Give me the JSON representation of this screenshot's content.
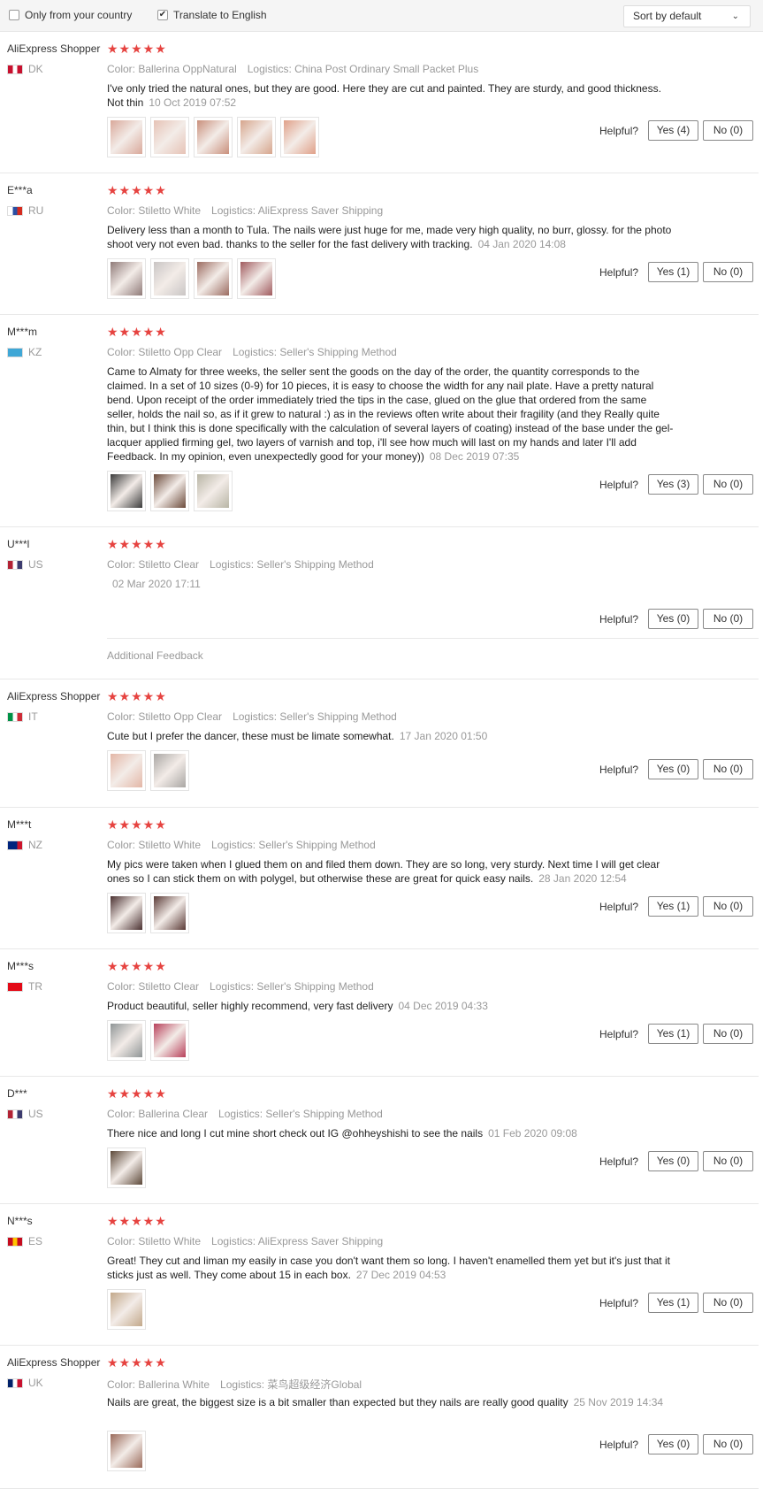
{
  "filters": {
    "only_country_label": "Only from your country",
    "translate_label": "Translate to English",
    "translate_checked_mark": "✔",
    "sort_label": "Sort by default",
    "sort_chevron": "⌄"
  },
  "common": {
    "helpful_label": "Helpful?",
    "stars": "★★★★★",
    "additional_feedback": "Additional Feedback"
  },
  "reviews": [
    {
      "user": "AliExpress Shopper",
      "country": "DK",
      "flag_colors": [
        "#c8102e",
        "#ffffff",
        "#c8102e"
      ],
      "color": "Color: Ballerina OppNatural",
      "logistics": "Logistics: China Post Ordinary Small Packet Plus",
      "text": "I've only tried the natural ones, but they are good. Here they are cut and painted. They are sturdy, and good thickness. Not thin",
      "date": "10 Oct 2019 07:52",
      "yes": "Yes (4)",
      "no": "No (0)",
      "images": [
        "#d9a89a",
        "#e6c2b5",
        "#c98f7b",
        "#d6a58c",
        "#e0a088"
      ]
    },
    {
      "user": "E***a",
      "country": "RU",
      "flag_colors": [
        "#ffffff",
        "#2a4fa3",
        "#d52b1e"
      ],
      "color": "Color: Stiletto White",
      "logistics": "Logistics: AliExpress Saver Shipping",
      "text": "Delivery less than a month to Tula. The nails were just huge for me, made very high quality, no burr, glossy. for the photo shoot very not even bad. thanks to the seller for the fast delivery with tracking.",
      "date": "04 Jan 2020 14:08",
      "yes": "Yes (1)",
      "no": "No (0)",
      "images": [
        "#8f7a78",
        "#c9c5c4",
        "#9b6b60",
        "#a05a5e"
      ]
    },
    {
      "user": "M***m",
      "country": "KZ",
      "flag_colors": [
        "#3fa7d6",
        "#3fa7d6",
        "#3fa7d6"
      ],
      "color": "Color: Stiletto Opp Clear",
      "logistics": "Logistics: Seller's Shipping Method",
      "text": "Came to Almaty for three weeks, the seller sent the goods on the day of the order, the quantity corresponds to the claimed. In a set of 10 sizes (0-9) for 10 pieces, it is easy to choose the width for any nail plate. Have a pretty natural bend. Upon receipt of the order immediately tried the tips in the case, glued on the glue that ordered from the same seller, holds the nail so, as if it grew to natural :) as in the reviews often write about their fragility (and they Really quite thin, but I think this is done specifically with the calculation of several layers of coating) instead of the base under the gel-lacquer applied firming gel, two layers of varnish and top, i'll see how much will last on my hands and later I'll add Feedback. In my opinion, even unexpectedly good for your money))",
      "date": "08 Dec 2019 07:35",
      "yes": "Yes (3)",
      "no": "No (0)",
      "images": [
        "#3a3a3a",
        "#6b4a3a",
        "#b8b5a5"
      ]
    },
    {
      "user": "U***l",
      "country": "US",
      "flag_colors": [
        "#b22234",
        "#ffffff",
        "#3c3b6e"
      ],
      "color": "Color: Stiletto Clear",
      "logistics": "Logistics: Seller's Shipping Method",
      "text": "",
      "date": "02 Mar 2020 17:11",
      "yes": "Yes (0)",
      "no": "No (0)",
      "images": []
    },
    {
      "user": "AliExpress Shopper",
      "country": "IT",
      "flag_colors": [
        "#009246",
        "#ffffff",
        "#ce2b37"
      ],
      "color": "Color: Stiletto Opp Clear",
      "logistics": "Logistics: Seller's Shipping Method",
      "text": "Cute but I prefer the dancer, these must be limate somewhat.",
      "date": "17 Jan 2020 01:50",
      "yes": "Yes (0)",
      "no": "No (0)",
      "images": [
        "#e3b6a6",
        "#a9a6a3"
      ]
    },
    {
      "user": "M***t",
      "country": "NZ",
      "flag_colors": [
        "#00247d",
        "#00247d",
        "#cc142b"
      ],
      "color": "Color: Stiletto White",
      "logistics": "Logistics: Seller's Shipping Method",
      "text": "My pics were taken when I glued them on and filed them down. They are so long, very sturdy. Next time I will get clear ones so I can stick them on with polygel, but otherwise these are great for quick easy nails.",
      "date": "28 Jan 2020 12:54",
      "yes": "Yes (1)",
      "no": "No (0)",
      "images": [
        "#4a3030",
        "#5a3a36"
      ]
    },
    {
      "user": "M***s",
      "country": "TR",
      "flag_colors": [
        "#e30a17",
        "#e30a17",
        "#e30a17"
      ],
      "color": "Color: Stiletto Clear",
      "logistics": "Logistics: Seller's Shipping Method",
      "text": "Product beautiful, seller highly recommend, very fast delivery",
      "date": "04 Dec 2019 04:33",
      "yes": "Yes (1)",
      "no": "No (0)",
      "images": [
        "#8f9596",
        "#b8405a"
      ]
    },
    {
      "user": "D***",
      "country": "US",
      "flag_colors": [
        "#b22234",
        "#ffffff",
        "#3c3b6e"
      ],
      "color": "Color: Ballerina Clear",
      "logistics": "Logistics: Seller's Shipping Method",
      "text": "There nice and long I cut mine short check out IG @ohheyshishi to see the nails",
      "date": "01 Feb 2020 09:08",
      "yes": "Yes (0)",
      "no": "No (0)",
      "images": [
        "#5c4838"
      ]
    },
    {
      "user": "N***s",
      "country": "ES",
      "flag_colors": [
        "#c60b1e",
        "#ffc400",
        "#c60b1e"
      ],
      "color": "Color: Stiletto White",
      "logistics": "Logistics: AliExpress Saver Shipping",
      "text": "Great! They cut and liman my easily in case you don't want them so long. I haven't enamelled them yet but it's just that it sticks just as well. They come about 15 in each box.",
      "date": "27 Dec 2019 04:53",
      "yes": "Yes (1)",
      "no": "No (0)",
      "images": [
        "#c2a88a"
      ]
    },
    {
      "user": "AliExpress Shopper",
      "country": "UK",
      "flag_colors": [
        "#012169",
        "#ffffff",
        "#c8102e"
      ],
      "color": "Color: Ballerina White",
      "logistics": "Logistics: 菜鸟超级经济Global",
      "text": "Nails are great, the biggest size is a bit smaller than expected but they nails are really good quality",
      "date": "25 Nov 2019 14:34",
      "yes": "Yes (0)",
      "no": "No (0)",
      "images": [
        "#9a6a5a"
      ]
    }
  ]
}
